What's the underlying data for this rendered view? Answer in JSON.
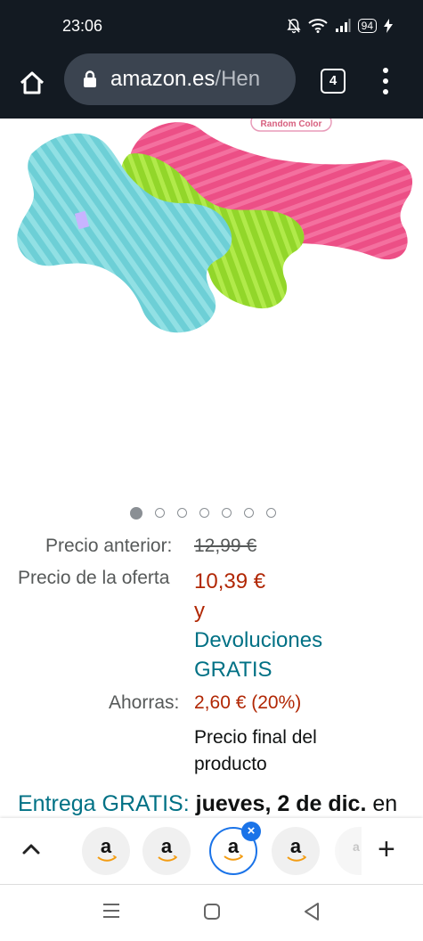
{
  "status_bar": {
    "time": "23:06",
    "battery": "94"
  },
  "browser": {
    "url_domain": "amazon.es",
    "url_path": "/Hen",
    "tab_count": "4"
  },
  "product_image": {
    "watermark": "Random Color"
  },
  "carousel": {
    "total": 7,
    "active_index": 0
  },
  "price": {
    "previous_label": "Precio anterior:",
    "previous_value": "12,99 €",
    "deal_label": "Precio de la oferta",
    "deal_value": "10,39 €",
    "and_text": "y",
    "returns_line1": "Devoluciones",
    "returns_line2": "GRATIS",
    "savings_label": "Ahorras:",
    "savings_value": "2,60 € (20%)",
    "final_line1": "Precio final del",
    "final_line2": "producto"
  },
  "delivery": {
    "free_label": "Entrega GRATIS:",
    "date": "jueves, 2 de dic.",
    "suffix": " en"
  },
  "tab_strip": {
    "tab_letter": "a"
  },
  "colors": {
    "toolbar_bg": "#131a22",
    "deal_red": "#b12704",
    "link_teal": "#007185",
    "active_tab_blue": "#1a73e8"
  }
}
